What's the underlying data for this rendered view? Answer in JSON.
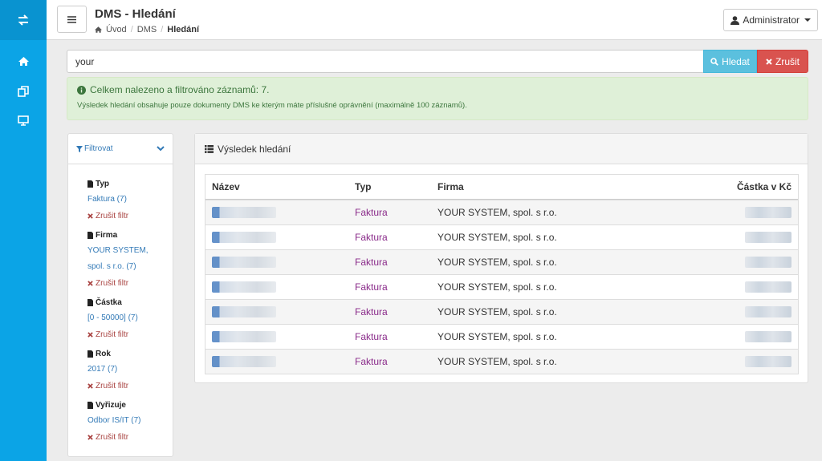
{
  "header": {
    "title": "DMS - Hledání",
    "breadcrumb": [
      "Úvod",
      "DMS",
      "Hledání"
    ],
    "user": "Administrator"
  },
  "rail": {
    "items": [
      "transfer-icon",
      "home-icon",
      "copy-icon",
      "monitor-icon"
    ]
  },
  "search": {
    "value": "your",
    "search_label": "Hledat",
    "cancel_label": "Zrušit"
  },
  "alert": {
    "line1": "Celkem nalezeno a filtrováno záznamů: 7.",
    "line2": "Výsledek hledání obsahuje pouze dokumenty DMS ke kterým máte příslušné oprávnění (maximálně 100 záznamů)."
  },
  "filter": {
    "title": "Filtrovat",
    "clear_label": "Zrušit filtr",
    "groups": [
      {
        "title": "Typ",
        "value": "Faktura  (7)"
      },
      {
        "title": "Firma",
        "value": "YOUR SYSTEM,",
        "value2": "spol. s r.o.  (7)"
      },
      {
        "title": "Částka",
        "value": "[0 - 50000]  (7)"
      },
      {
        "title": "Rok",
        "value": "2017  (7)"
      },
      {
        "title": "Vyřizuje",
        "value": "Odbor IS/IT  (7)"
      }
    ]
  },
  "results": {
    "title": "Výsledek hledání",
    "columns": [
      "Název",
      "Typ",
      "Firma",
      "Částka v Kč"
    ],
    "rows": [
      {
        "type": "Faktura",
        "firm": "YOUR SYSTEM, spol. s r.o."
      },
      {
        "type": "Faktura",
        "firm": "YOUR SYSTEM, spol. s r.o."
      },
      {
        "type": "Faktura",
        "firm": "YOUR SYSTEM, spol. s r.o."
      },
      {
        "type": "Faktura",
        "firm": "YOUR SYSTEM, spol. s r.o."
      },
      {
        "type": "Faktura",
        "firm": "YOUR SYSTEM, spol. s r.o."
      },
      {
        "type": "Faktura",
        "firm": "YOUR SYSTEM, spol. s r.o."
      },
      {
        "type": "Faktura",
        "firm": "YOUR SYSTEM, spol. s r.o."
      }
    ]
  },
  "colors": {
    "rail": "#0ba4e6",
    "accent": "#337ab7",
    "success_bg": "#dff0d8",
    "danger": "#d9534f",
    "info": "#5bc0de"
  }
}
